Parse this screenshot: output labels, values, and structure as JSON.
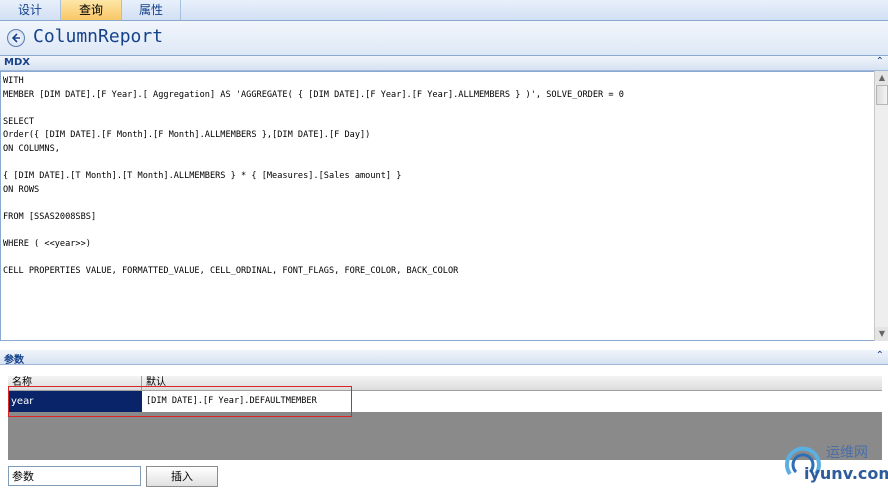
{
  "tabs": [
    {
      "label": "设计",
      "active": false
    },
    {
      "label": "查询",
      "active": true
    },
    {
      "label": "属性",
      "active": false
    }
  ],
  "page": {
    "title": "ColumnReport"
  },
  "mdx_section": {
    "label": "MDX"
  },
  "mdx_query": "WITH\nMEMBER [DIM DATE].[F Year].[ Aggregation] AS 'AGGREGATE( { [DIM DATE].[F Year].[F Year].ALLMEMBERS } )', SOLVE_ORDER = 0\n\nSELECT\nOrder({ [DIM DATE].[F Month].[F Month].ALLMEMBERS },[DIM DATE].[F Day])\nON COLUMNS,\n\n{ [DIM DATE].[T Month].[T Month].ALLMEMBERS } * { [Measures].[Sales amount] }\nON ROWS\n\nFROM [SSAS2008SBS]\n\nWHERE ( <<year>>)\n\nCELL PROPERTIES VALUE, FORMATTED_VALUE, CELL_ORDINAL, FONT_FLAGS, FORE_COLOR, BACK_COLOR",
  "params_section": {
    "label": "参数"
  },
  "params_table": {
    "columns": [
      "名称",
      "默认"
    ],
    "rows": [
      {
        "name": "year",
        "default": "[DIM DATE].[F Year].DEFAULTMEMBER"
      }
    ]
  },
  "add_param": {
    "input_value": "参数",
    "button_label": "插入"
  },
  "watermark": {
    "cn": "运维网",
    "en": "iyunv.com"
  },
  "colors": {
    "tab_active": "#f8c765",
    "title": "#15428b",
    "selection": "#0a246a",
    "highlight_box": "#d8262b"
  }
}
